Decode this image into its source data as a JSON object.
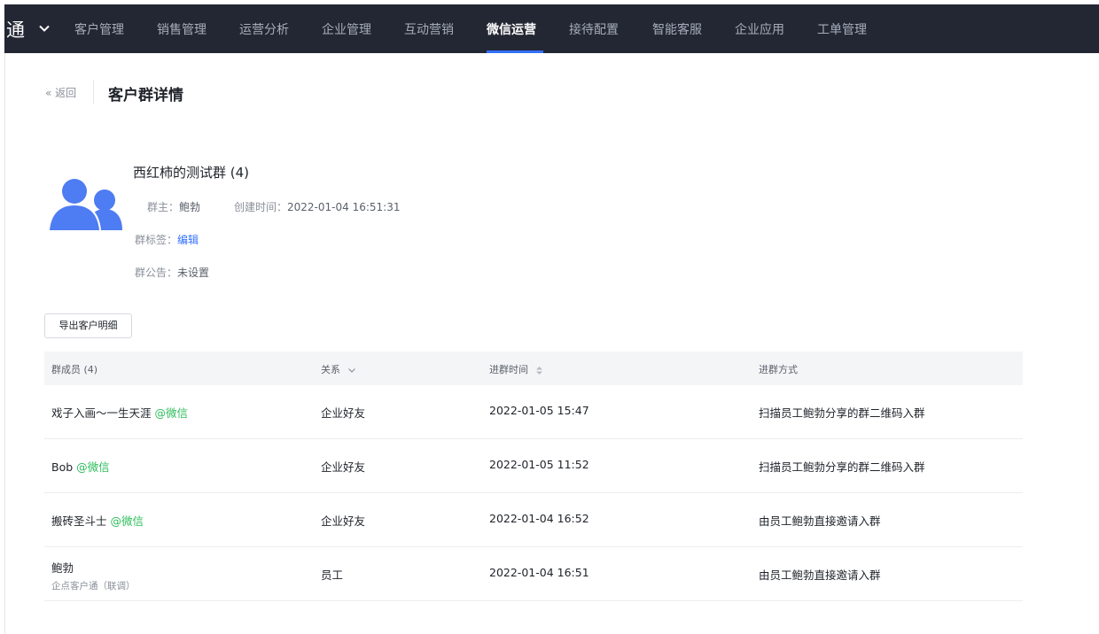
{
  "nav": {
    "brand": "通",
    "items": [
      {
        "label": "客户管理"
      },
      {
        "label": "销售管理"
      },
      {
        "label": "运营分析"
      },
      {
        "label": "企业管理"
      },
      {
        "label": "互动营销"
      },
      {
        "label": "微信运营",
        "active": true
      },
      {
        "label": "接待配置"
      },
      {
        "label": "智能客服"
      },
      {
        "label": "企业应用"
      },
      {
        "label": "工单管理"
      }
    ]
  },
  "header": {
    "back_label": "« 返回",
    "title": "客户群详情"
  },
  "group": {
    "name": "西红柿的测试群 (4)",
    "owner_label": "群主：",
    "owner": "鲍勃",
    "created_label": "创建时间：",
    "created": "2022-01-04 16:51:31",
    "tags_label": "群标签：",
    "tags_edit": "编辑",
    "notice_label": "群公告：",
    "notice": "未设置"
  },
  "export_label": "导出客户明细",
  "table": {
    "headers": [
      "群成员 (4)",
      "关系",
      "进群时间",
      "进群方式"
    ],
    "rows": [
      {
        "name": "戏子入画～一生天涯",
        "wechat": "@微信",
        "sub": "",
        "relation": "企业好友",
        "time": "2022-01-05 15:47",
        "method": "扫描员工鲍勃分享的群二维码入群"
      },
      {
        "name": "Bob",
        "wechat": "@微信",
        "sub": "",
        "relation": "企业好友",
        "time": "2022-01-05 11:52",
        "method": "扫描员工鲍勃分享的群二维码入群"
      },
      {
        "name": "搬砖圣斗士",
        "wechat": "@微信",
        "sub": "",
        "relation": "企业好友",
        "time": "2022-01-04 16:52",
        "method": "由员工鲍勃直接邀请入群"
      },
      {
        "name": "鲍勃",
        "wechat": "",
        "sub": "企点客户通（联调）",
        "relation": "员工",
        "time": "2022-01-04 16:51",
        "method": "由员工鲍勃直接邀请入群"
      }
    ]
  },
  "colors": {
    "nav_bg": "#232733",
    "accent": "#3370ff",
    "wechat_green": "#2dbd5b",
    "avatar_blue": "#4e7cf2"
  }
}
